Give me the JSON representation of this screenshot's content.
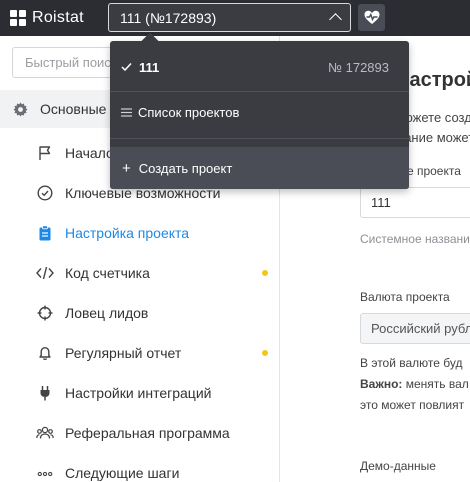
{
  "topbar": {
    "logo_text": "Roistat",
    "project_selector": "111 (№172893)",
    "health_icon": "heart-pulse-icon"
  },
  "sidebar": {
    "search_placeholder": "Быстрый поиск",
    "section_label": "Основные",
    "items": [
      {
        "label": "Начало",
        "icon": "flag-icon"
      },
      {
        "label": "Ключевые возможности",
        "icon": "check-circle-icon"
      },
      {
        "label": "Настройка проекта",
        "icon": "clipboard-icon",
        "active": true
      },
      {
        "label": "Код счетчика",
        "icon": "code-icon",
        "badge": true
      },
      {
        "label": "Ловец лидов",
        "icon": "crosshair-icon"
      },
      {
        "label": "Регулярный отчет",
        "icon": "bell-icon",
        "badge": true
      },
      {
        "label": "Настройки интеграций",
        "icon": "plug-icon"
      },
      {
        "label": "Реферальная программа",
        "icon": "people-icon"
      },
      {
        "label": "Следующие шаги",
        "icon": "more-dots-icon"
      }
    ]
  },
  "dropdown": {
    "current_project": "111",
    "current_project_number": "№ 172893",
    "list_label": "Список проектов",
    "create_label": "Создать проект"
  },
  "main": {
    "title": "Настройка",
    "intro_line1": "Вы можете создать п",
    "intro_line2": "Название может быть",
    "project_name_label": "Название проекта",
    "project_name_value": "111",
    "system_name_hint": "Системное название",
    "currency_label": "Валюта проекта",
    "currency_value": "Российский рубль",
    "currency_note_line1": "В этой валюте буд",
    "currency_note_bold": "Важно:",
    "currency_note_line2": " менять вал",
    "currency_note_line3": "это может повлият",
    "demo_label": "Демо-данные"
  },
  "colors": {
    "topbar_bg": "#2b2d33",
    "accent": "#1e88e5",
    "badge": "#f5c518",
    "dropdown_bg": "#3a3c42"
  }
}
